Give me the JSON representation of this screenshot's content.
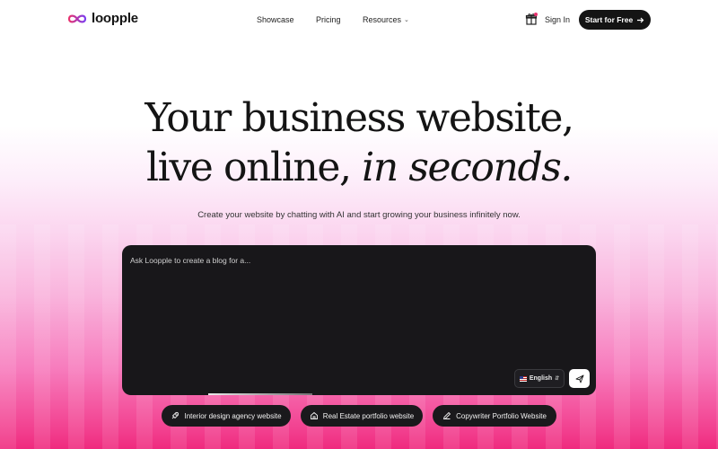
{
  "brand": {
    "name": "loopple",
    "logo_icon": "infinity-icon",
    "accent": "#e8326e"
  },
  "nav": {
    "links": [
      {
        "label": "Showcase"
      },
      {
        "label": "Pricing"
      },
      {
        "label": "Resources",
        "icon": "chevron-down-icon"
      }
    ],
    "gift_icon": "gift-icon",
    "signin_label": "Sign In",
    "cta_label": "Start for Free",
    "cta_icon": "arrow-right-icon"
  },
  "hero": {
    "line1": "Your business website,",
    "line2_plain": "live online, ",
    "line2_italic": "in seconds.",
    "subtitle": "Create your website by chatting with AI and start growing your business infinitely now."
  },
  "prompt": {
    "placeholder": "Ask Loopple to create a blog for a...",
    "language": "English",
    "send_icon": "send-icon"
  },
  "suggestions": [
    {
      "label": "Interior design agency website",
      "icon": "rocket-icon"
    },
    {
      "label": "Real Estate portfolio website",
      "icon": "home-icon"
    },
    {
      "label": "Copywriter Portfolio Website",
      "icon": "pen-icon"
    }
  ],
  "colors": {
    "dark": "#141414",
    "prompt_bg": "#18171a",
    "gradient_pink": "#ef2a7e"
  }
}
